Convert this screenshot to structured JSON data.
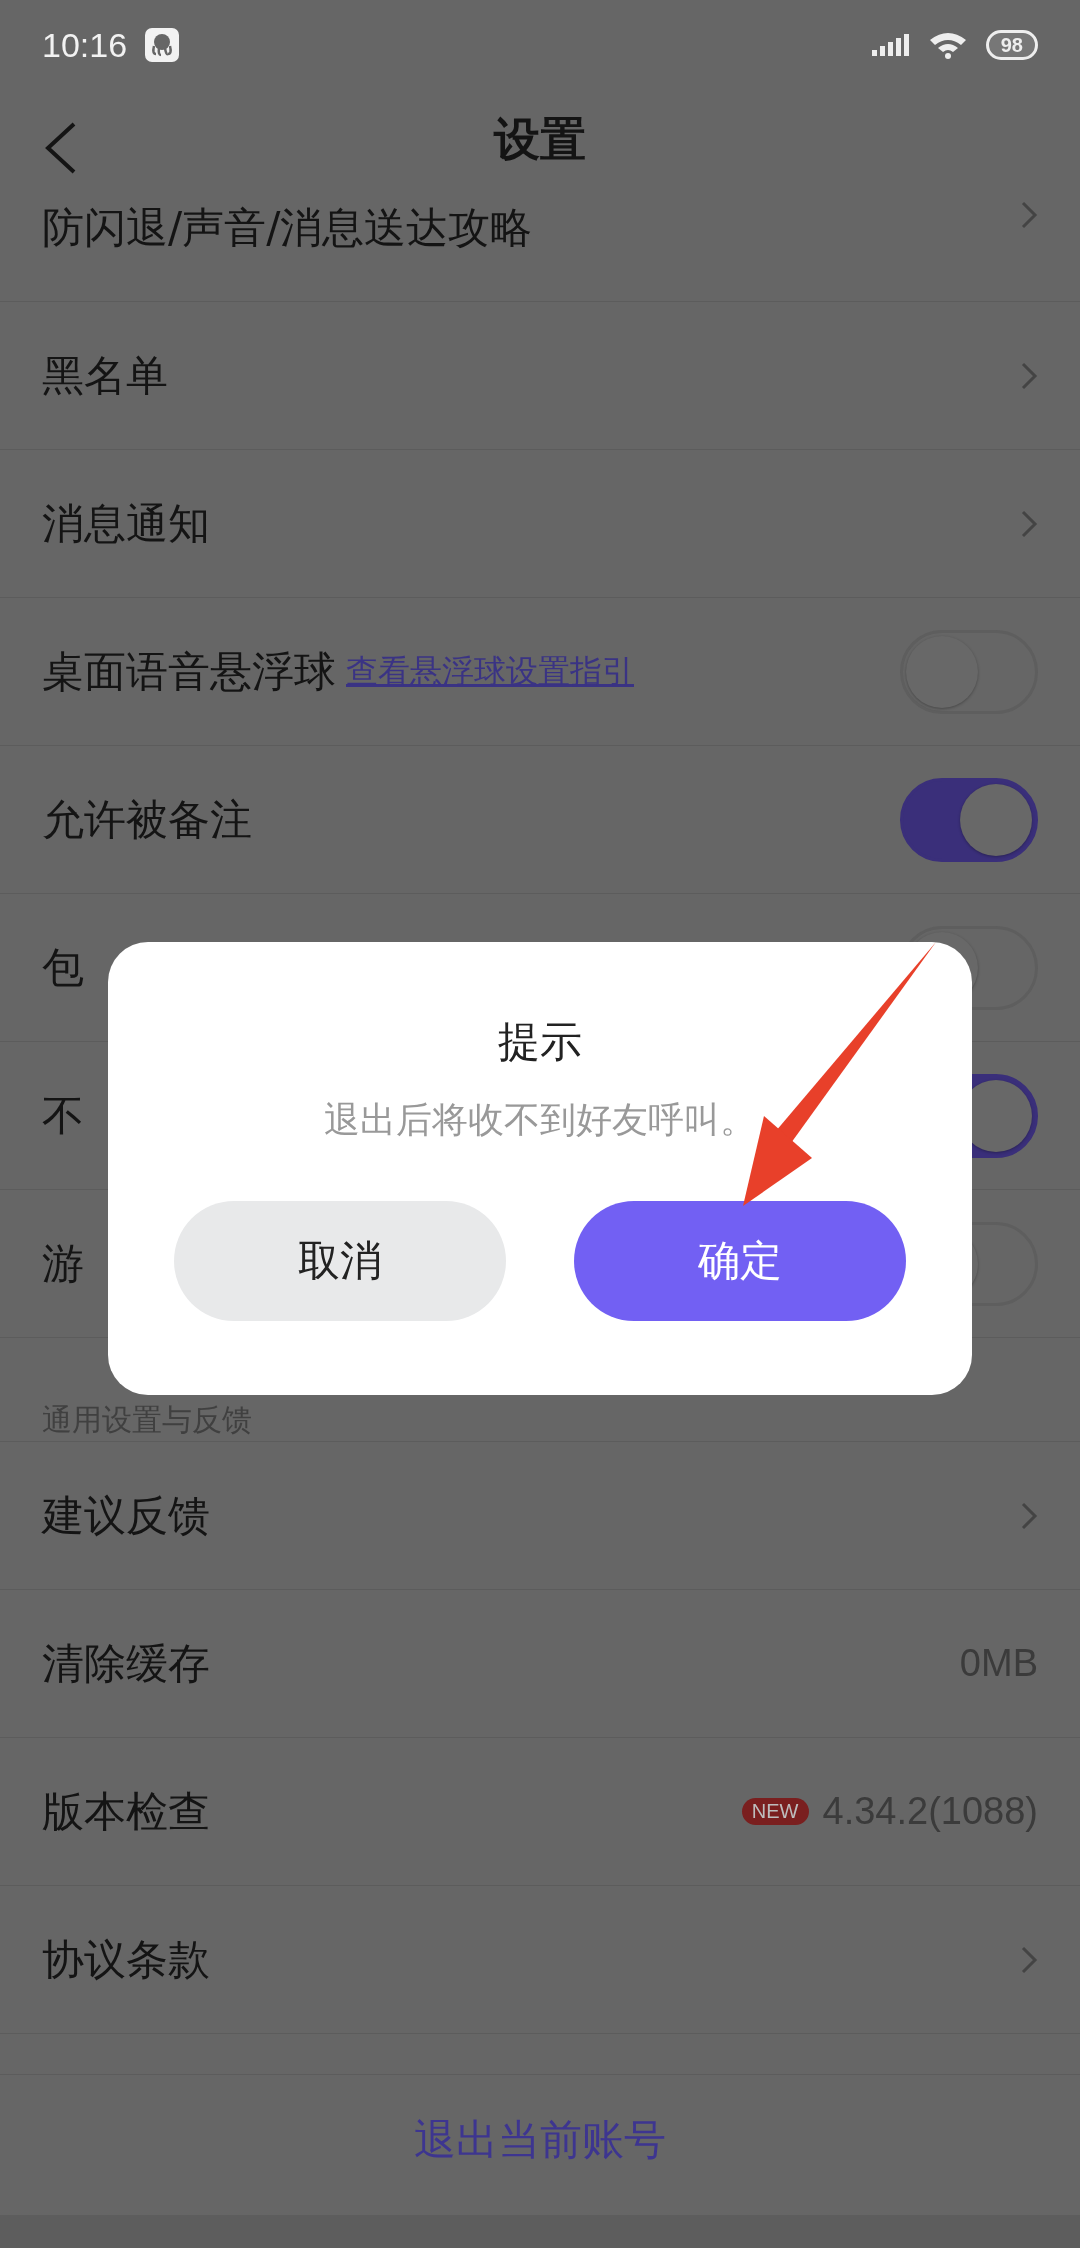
{
  "status_bar": {
    "time": "10:16",
    "battery": "98"
  },
  "header": {
    "title": "设置"
  },
  "rows": [
    {
      "kind": "nav",
      "label": "防闪退/声音/消息送达攻略"
    },
    {
      "kind": "nav",
      "label": "黑名单"
    },
    {
      "kind": "nav",
      "label": "消息通知"
    },
    {
      "kind": "toggle",
      "label": "桌面语音悬浮球",
      "link": "查看悬浮球设置指引",
      "on": false
    },
    {
      "kind": "toggle",
      "label": "允许被备注",
      "on": true
    },
    {
      "kind": "toggle",
      "label": "包",
      "on": false
    },
    {
      "kind": "toggle",
      "label": "不",
      "on": true
    },
    {
      "kind": "toggle",
      "label": "游",
      "on": false
    },
    {
      "kind": "section",
      "label": "通用设置与反馈"
    },
    {
      "kind": "nav",
      "label": "建议反馈"
    },
    {
      "kind": "value",
      "label": "清除缓存",
      "value": "0MB"
    },
    {
      "kind": "value",
      "label": "版本检查",
      "badge": "NEW",
      "value": "4.34.2(1088)"
    },
    {
      "kind": "nav",
      "label": "协议条款"
    }
  ],
  "logout": "退出当前账号",
  "dialog": {
    "title": "提示",
    "message": "退出后将收不到好友呼叫。",
    "buttons": [
      {
        "kind": "cancel",
        "label": "取消"
      },
      {
        "kind": "confirm",
        "label": "确定"
      }
    ]
  }
}
